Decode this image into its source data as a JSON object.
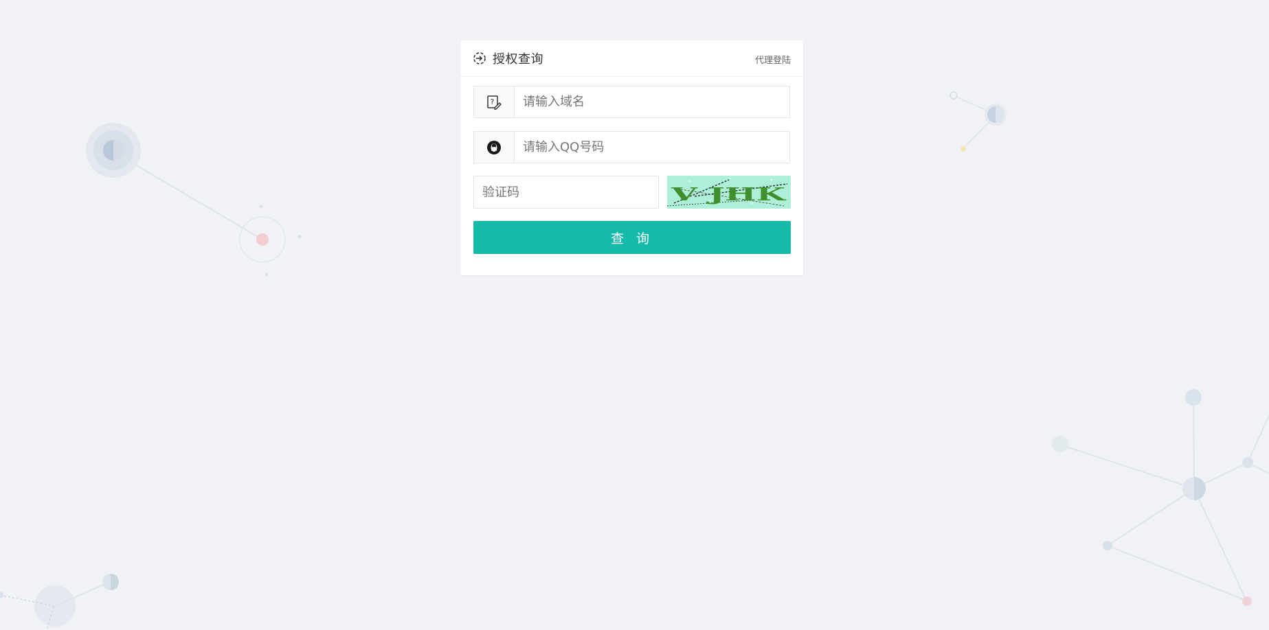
{
  "header": {
    "title": "授权查询",
    "agent_login": "代理登陆"
  },
  "form": {
    "domain_placeholder": "请输入域名",
    "qq_placeholder": "请输入QQ号码",
    "captcha_placeholder": "验证码",
    "captcha_text": "V JHK",
    "submit_label": "查 询"
  },
  "colors": {
    "accent": "#16baaa",
    "background": "#f0f2f5"
  },
  "icons": {
    "header": "query-icon",
    "domain": "domain-edit-icon",
    "qq": "qq-penguin-icon"
  }
}
